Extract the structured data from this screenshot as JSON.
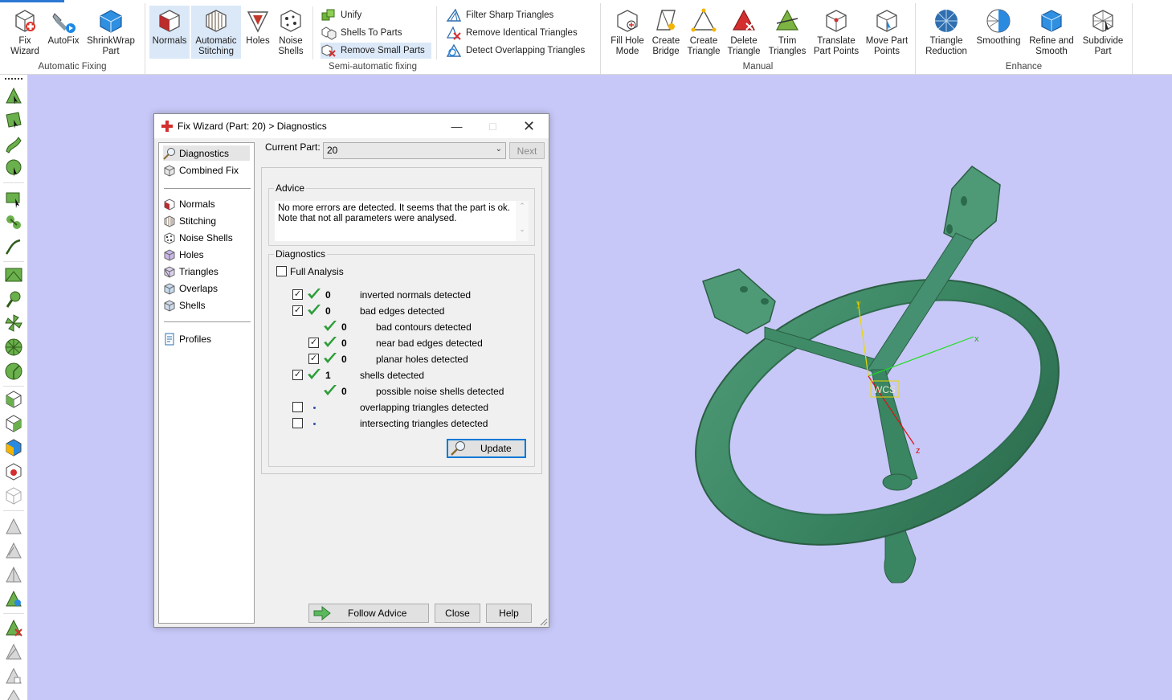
{
  "ribbon": {
    "groups": {
      "automatic_fixing": "Automatic Fixing",
      "semi_automatic_fixing": "Semi-automatic fixing",
      "manual": "Manual",
      "enhance": "Enhance"
    },
    "buttons": {
      "fix_wizard": [
        "Fix",
        "Wizard"
      ],
      "autofix": [
        "AutoFix",
        ""
      ],
      "shrinkwrap": [
        "ShrinkWrap",
        "Part"
      ],
      "normals": [
        "Normals",
        ""
      ],
      "automatic_stitching": [
        "Automatic",
        "Stitching"
      ],
      "holes": [
        "Holes",
        ""
      ],
      "noise_shells": [
        "Noise",
        "Shells"
      ],
      "unify": "Unify",
      "shells_to_parts": "Shells To Parts",
      "remove_small_parts": "Remove Small Parts",
      "filter_sharp_triangles": "Filter Sharp Triangles",
      "remove_identical_triangles": "Remove Identical Triangles",
      "detect_overlapping_triangles": "Detect Overlapping Triangles",
      "fill_hole_mode": [
        "Fill Hole",
        "Mode"
      ],
      "create_bridge": [
        "Create",
        "Bridge"
      ],
      "create_triangle": [
        "Create",
        "Triangle"
      ],
      "delete_triangle": [
        "Delete",
        "Triangle"
      ],
      "trim_triangles": [
        "Trim",
        "Triangles"
      ],
      "translate_part_points": [
        "Translate",
        "Part Points"
      ],
      "move_part_points": [
        "Move Part",
        "Points"
      ],
      "triangle_reduction": [
        "Triangle",
        "Reduction"
      ],
      "smoothing": [
        "Smoothing",
        ""
      ],
      "refine_and_smooth": [
        "Refine and",
        "Smooth"
      ],
      "subdivide_part": [
        "Subdivide",
        "Part"
      ]
    }
  },
  "dialog": {
    "title": "Fix Wizard (Part: 20) > Diagnostics",
    "nav": {
      "diagnostics": "Diagnostics",
      "combined_fix": "Combined Fix",
      "normals": "Normals",
      "stitching": "Stitching",
      "noise_shells": "Noise Shells",
      "holes": "Holes",
      "triangles": "Triangles",
      "overlaps": "Overlaps",
      "shells": "Shells",
      "profiles": "Profiles"
    },
    "current_part_label": "Current Part:",
    "current_part_value": "20",
    "next_label": "Next",
    "advice_title": "Advice",
    "advice_line1": "No more errors are detected. It seems that the part is ok.",
    "advice_line2": "Note that not all parameters were analysed.",
    "diagnostics_title": "Diagnostics",
    "full_analysis_label": "Full Analysis",
    "rows": [
      {
        "count": "0",
        "label": "inverted normals detected",
        "checked": true
      },
      {
        "count": "0",
        "label": "bad edges detected",
        "checked": true
      },
      {
        "count": "0",
        "label": "bad contours detected"
      },
      {
        "count": "0",
        "label": "near bad edges detected",
        "checked": true
      },
      {
        "count": "0",
        "label": "planar holes detected",
        "checked": true
      },
      {
        "count": "1",
        "label": "shells detected",
        "checked": true
      },
      {
        "count": "0",
        "label": "possible noise shells detected"
      },
      {
        "count": "",
        "label": "overlapping triangles detected",
        "checked": false
      },
      {
        "count": "",
        "label": "intersecting triangles detected",
        "checked": false
      }
    ],
    "update_label": "Update",
    "follow_advice_label": "Follow Advice",
    "close_label": "Close",
    "help_label": "Help"
  },
  "viewport": {
    "axis_x": "x",
    "axis_y": "y",
    "axis_z": "z",
    "wcs_label": "WCS",
    "model_color": "#3e8a65",
    "background_color": "#c8c8f8"
  }
}
